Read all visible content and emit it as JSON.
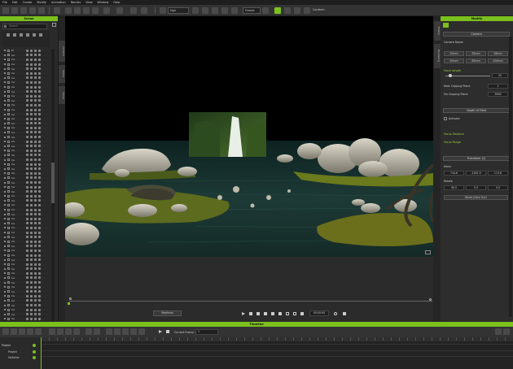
{
  "menu": [
    "File",
    "Edit",
    "Create",
    "Modify",
    "Animation",
    "Render",
    "View",
    "Window",
    "Help"
  ],
  "toolbar": {
    "quality": "High",
    "frames": "Frames",
    "conform": "Conform"
  },
  "scene_panel": {
    "title": "Scene",
    "search_placeholder": "Search",
    "rows": [
      "Pl",
      "Ca",
      "Ca",
      "Ca",
      "Ca",
      "Ca",
      "Ca",
      "Ca",
      "Ca",
      "Ca",
      "Ca",
      "Ca",
      "Ca",
      "Ca",
      "Ca",
      "Ca",
      "Ca",
      "Ca",
      "Ca",
      "Ca",
      "Ca",
      "Ca",
      "Ca",
      "Ca",
      "Ca",
      "Ca",
      "Ca",
      "Ca",
      "Ca",
      "Ca",
      "Ca",
      "Ca",
      "Ca",
      "Ca",
      "Ca",
      "Ca",
      "Ca",
      "Ca",
      "Ca",
      "Ca",
      "Ca",
      "Ca",
      "Ca",
      "Ca",
      "Ca",
      "Ca",
      "Ca",
      "Ca",
      "Ca",
      "Ca",
      "Ca",
      "Ca",
      "Ca",
      "Ca",
      "Ca",
      "Ca",
      "Ca",
      "Ca",
      "Ca",
      "Ca"
    ]
  },
  "left_tabs": [
    "Content",
    "Scene",
    "Visual"
  ],
  "viewport": {
    "hud_fps": "FPS: 0",
    "hud_project": "Project Polygon : 413921",
    "hud_selected": "Selected Polygon : 0"
  },
  "right_tabs": [
    "Modify",
    "Rendering"
  ],
  "modify": {
    "title": "Modify",
    "camera_section": "Camera",
    "camera_name_label": "Camera Name",
    "lens_values": [
      "20mm",
      "35mm",
      "28mm",
      "50mm",
      "85mm",
      "200mm"
    ],
    "focal_length_label": "Focal Length",
    "focal_length_value": "20",
    "near_clip_label": "Near Clipping Plane",
    "near_clip_value": "1",
    "far_clip_label": "Far Clipping Plane",
    "far_clip_value": "9999",
    "dof_section": "Depth of Field",
    "dof_activate": "Activate",
    "focus_distance_label": "Focus Distance",
    "focus_range_label": "Focus Range",
    "transform_section": "Transform (1)",
    "move_label": "Move",
    "move_x": "744.6",
    "move_y": "-1261.9",
    "move_z": "113.8",
    "rotate_label": "Rotate",
    "rotate_x": "90.0",
    "rotate_y": "0.0",
    "rotate_z": "0.0",
    "reset_label": "Reset (Zero Out)"
  },
  "playback": {
    "realtime_label": "Realtime",
    "timecode": "00:00:00"
  },
  "timeline": {
    "title": "Timeline",
    "current_frame_label": "Current Frame :",
    "current_frame_value": "1",
    "tracks": [
      "Project",
      "Project",
      "Switcher"
    ]
  },
  "colors": {
    "accent": "#7cc01e"
  }
}
